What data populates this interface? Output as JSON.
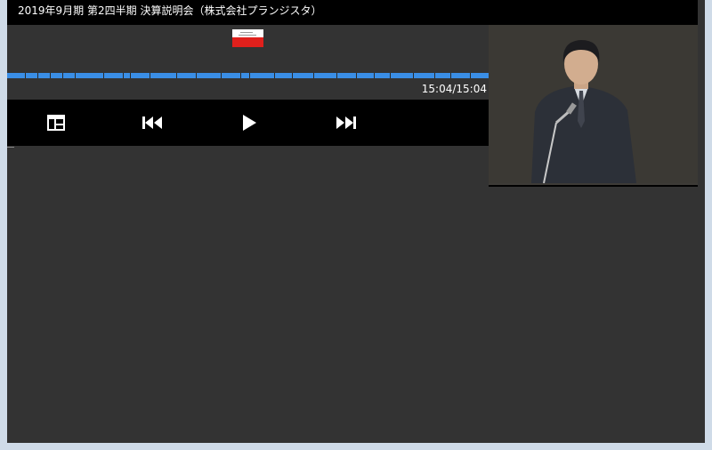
{
  "window": {
    "title": "2019年9月期 第2四半期 決算説明会（株式会社プランジスタ）"
  },
  "player": {
    "time_display": "15:04/15:04",
    "progress_fraction": 1.0,
    "controls": [
      {
        "name": "layout-toggle-button",
        "icon": "layout-icon"
      },
      {
        "name": "previous-slide-button",
        "icon": "skip-back-icon"
      },
      {
        "name": "play-button",
        "icon": "play-icon"
      },
      {
        "name": "next-slide-button",
        "icon": "skip-forward-icon"
      }
    ]
  },
  "colors": {
    "background": "#333333",
    "title_bar": "#000000",
    "progress": "#3a8ee6",
    "frame": "#cfdbe8"
  }
}
